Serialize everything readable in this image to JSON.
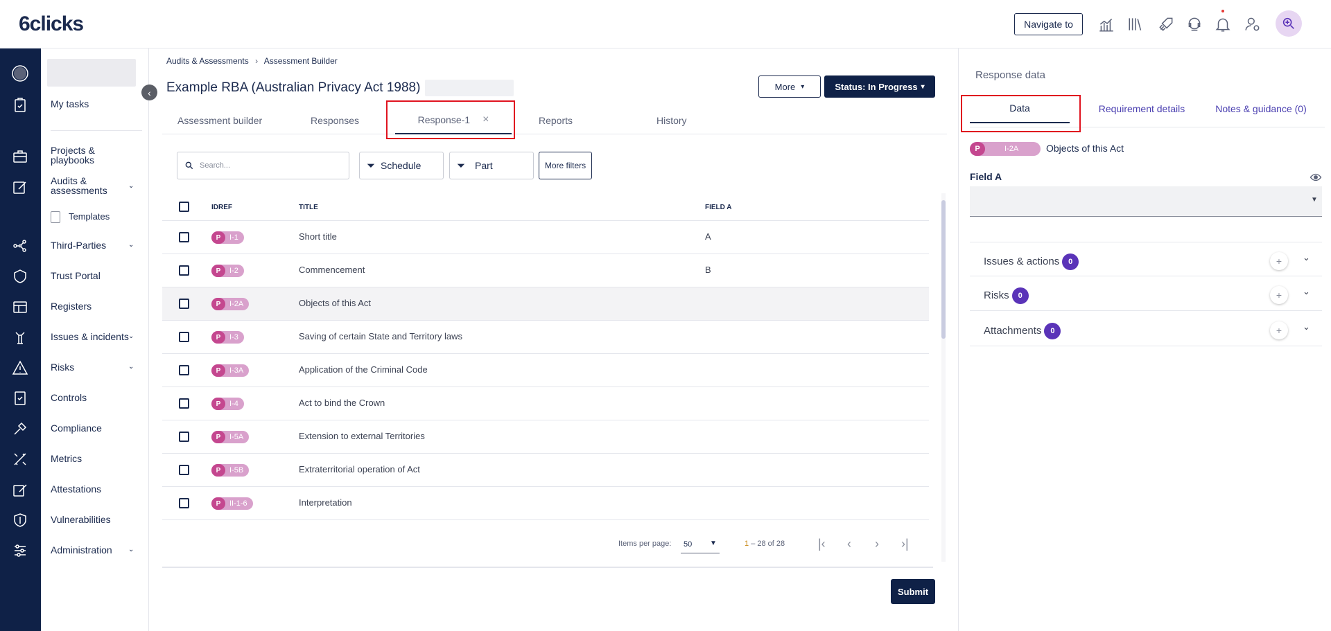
{
  "app": {
    "logo": "6clicks",
    "navigate_label": "Navigate to"
  },
  "sidebar": {
    "items": [
      {
        "label": "My tasks"
      },
      {
        "label": "Projects & playbooks"
      },
      {
        "label": "Audits & assessments"
      },
      {
        "label": "Templates"
      },
      {
        "label": "Third-Parties"
      },
      {
        "label": "Trust Portal"
      },
      {
        "label": "Registers"
      },
      {
        "label": "Issues & incidents"
      },
      {
        "label": "Risks"
      },
      {
        "label": "Controls"
      },
      {
        "label": "Compliance"
      },
      {
        "label": "Metrics"
      },
      {
        "label": "Attestations"
      },
      {
        "label": "Vulnerabilities"
      },
      {
        "label": "Administration"
      }
    ]
  },
  "breadcrumb": {
    "items": [
      "Audits & Assessments",
      "Assessment Builder"
    ],
    "sep": "›"
  },
  "page": {
    "title": "Example RBA (Australian Privacy Act 1988)",
    "more_label": "More",
    "status_label": "Status: In Progress"
  },
  "tabs": [
    {
      "label": "Assessment builder"
    },
    {
      "label": "Responses"
    },
    {
      "label": "Response-1",
      "close": "×"
    },
    {
      "label": "Reports"
    },
    {
      "label": "History"
    }
  ],
  "filters": {
    "search_placeholder": "Search...",
    "schedule": "Schedule",
    "part": "Part",
    "more_filters": "More filters"
  },
  "table": {
    "headers": [
      "IDREF",
      "TITLE",
      "FIELD A"
    ],
    "rows": [
      {
        "p": "P",
        "ref": "I-1",
        "title": "Short title",
        "field": "A"
      },
      {
        "p": "P",
        "ref": "I-2",
        "title": "Commencement",
        "field": "B"
      },
      {
        "p": "P",
        "ref": "I-2A",
        "title": "Objects of this Act",
        "field": ""
      },
      {
        "p": "P",
        "ref": "I-3",
        "title": "Saving of certain State and Territory laws",
        "field": ""
      },
      {
        "p": "P",
        "ref": "I-3A",
        "title": "Application of the Criminal Code",
        "field": ""
      },
      {
        "p": "P",
        "ref": "I-4",
        "title": "Act to bind the Crown",
        "field": ""
      },
      {
        "p": "P",
        "ref": "I-5A",
        "title": "Extension to external Territories",
        "field": ""
      },
      {
        "p": "P",
        "ref": "I-5B",
        "title": "Extraterritorial operation of Act",
        "field": ""
      },
      {
        "p": "P",
        "ref": "II-1-6",
        "title": "Interpretation",
        "field": ""
      }
    ]
  },
  "pager": {
    "items_per_page_label": "Items per page:",
    "items_per_page": "50",
    "range_start": "1",
    "range_rest": "– 28 of 28"
  },
  "submit_label": "Submit",
  "right": {
    "title": "Response data",
    "tabs": [
      "Data",
      "Requirement details",
      "Notes & guidance (0)"
    ],
    "badge": {
      "p": "P",
      "ref": "I-2A"
    },
    "requirement_title": "Objects of this Act",
    "field_label": "Field A",
    "sections": [
      {
        "label": "Issues & actions",
        "count": "0"
      },
      {
        "label": "Risks",
        "count": "0"
      },
      {
        "label": "Attachments",
        "count": "0"
      }
    ]
  },
  "colors": {
    "navy": "#0f2147",
    "highlight_red": "#e0131f",
    "badge_pink": "#c4478f",
    "count_purple": "#5a33b8"
  }
}
